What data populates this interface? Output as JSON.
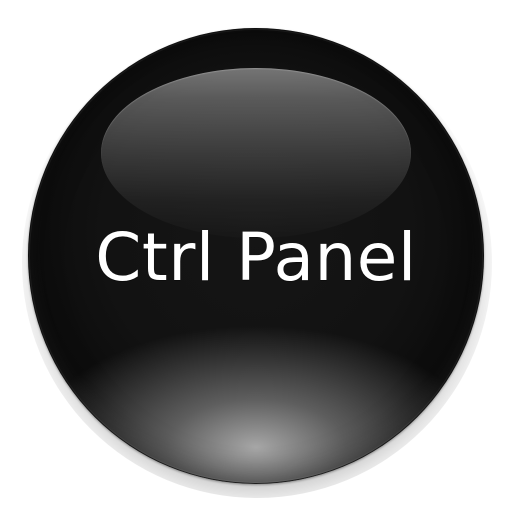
{
  "button": {
    "label": "Ctrl Panel",
    "icon": "glossy-sphere-icon",
    "colors": {
      "orb": "#111111",
      "text": "#ffffff",
      "highlight": "#d9d9d9"
    }
  }
}
